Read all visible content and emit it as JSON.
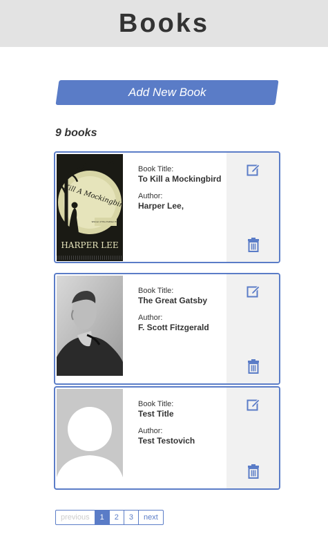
{
  "header": {
    "title": "Books"
  },
  "add_button": {
    "label": "Add New Book"
  },
  "book_count": "9 books",
  "labels": {
    "title": "Book Title:",
    "author": "Author:"
  },
  "books": [
    {
      "title": "To Kill a Mockingbird",
      "author": "Harper Lee,",
      "cover": {
        "type": "mockingbird",
        "cover_title": "To Kill A Mockingbird",
        "cover_author": "HARPER LEE",
        "cover_note": "Winner of the Pulitzer Prize"
      }
    },
    {
      "title": "The Great Gatsby",
      "author": "F. Scott Fitzgerald",
      "cover": {
        "type": "photo-portrait"
      }
    },
    {
      "title": "Test Title",
      "author": "Test Testovich",
      "cover": {
        "type": "placeholder-avatar"
      }
    }
  ],
  "icons": {
    "edit": "edit-icon",
    "delete": "trash-icon"
  },
  "colors": {
    "accent": "#5a7cc7",
    "header_bg": "#e3e3e3",
    "actions_bg": "#f1f1f1"
  },
  "pagination": {
    "previous": "previous",
    "pages": [
      "1",
      "2",
      "3"
    ],
    "current": "1",
    "next": "next"
  }
}
